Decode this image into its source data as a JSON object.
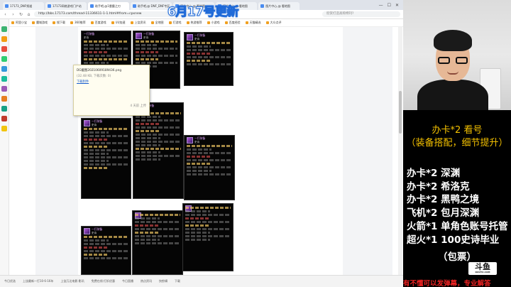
{
  "overlay_title": "6月17号更新",
  "browser": {
    "tabs": [
      {
        "label": "17173_DNF频道"
      },
      {
        "label": "17173网络游戏门户站"
      },
      {
        "label": "助手吧,@1雷霆之刃"
      },
      {
        "label": "助手吧,@ DNF_DNF专区"
      },
      {
        "label": "图片中心,@ 看地图"
      },
      {
        "label": "图片中心,@ 看地图"
      },
      {
        "label": "图片中心,@ 看地图"
      }
    ],
    "url": "http://bbs.17173.com/thread-11336611-1-1.html#from=cpxnew",
    "search_placeholder": "欣赏打造高购特刊?",
    "window_controls": [
      "—",
      "☐",
      "✕"
    ],
    "bookmarks": [
      {
        "label": "阿里小宝"
      },
      {
        "label": "魔域游戏"
      },
      {
        "label": "搜下载"
      },
      {
        "label": "360推荐"
      },
      {
        "label": "百度游戏"
      },
      {
        "label": "UU加速"
      },
      {
        "label": "上饶资讯"
      },
      {
        "label": "全地图"
      },
      {
        "label": "打游戏"
      },
      {
        "label": "热游推荐"
      },
      {
        "label": "小游戏"
      },
      {
        "label": "百度经验"
      },
      {
        "label": "天猫精选"
      },
      {
        "label": "大众点评"
      }
    ],
    "tooltip": {
      "filename": "DG截图20210609189436.png",
      "meta": "(32.48 KB, 下载次数: 0)",
      "link": "下载附件",
      "time": "4 天前 上传"
    },
    "status": {
      "items": [
        "今日优选",
        "上饶最新一打10·6-16年",
        "上饶万达电影·影讯",
        "免费在线·打折优惠",
        "今日直播",
        "热点资讯",
        "快剪辑",
        "下载"
      ]
    }
  },
  "cards": [
    {
      "title": "一打装备",
      "grade": "史诗"
    },
    {
      "title": "一打装备",
      "grade": "史诗"
    },
    {
      "title": "一打装备",
      "grade": "史诗"
    },
    {
      "title": "一打装备",
      "grade": "史诗"
    },
    {
      "title": "一打装备",
      "grade": "史诗"
    },
    {
      "title": "一打装备",
      "grade": "史诗"
    },
    {
      "title": "一打装备",
      "grade": "史诗"
    }
  ],
  "panel": {
    "heading1": "办卡*2  看号",
    "heading2": "（装备搭配，细节提升）",
    "rows": [
      "办卡*2  深渊",
      "办卡*2  希洛克",
      "办卡*2  黑鸭之境",
      "飞机*2  包月深渊",
      "火箭*1  单角色账号托管",
      "超火*1  100史诗毕业"
    ],
    "last_row": "（包票）",
    "logo": "斗鱼",
    "logo_sub": "DOUYU.COM",
    "footer": "有不懂可以发弹幕，专业解答"
  },
  "colors": {
    "overlay_gold": "#f3c000",
    "footer_red": "#ee2222",
    "title_stroke": "#1f6ad8"
  }
}
